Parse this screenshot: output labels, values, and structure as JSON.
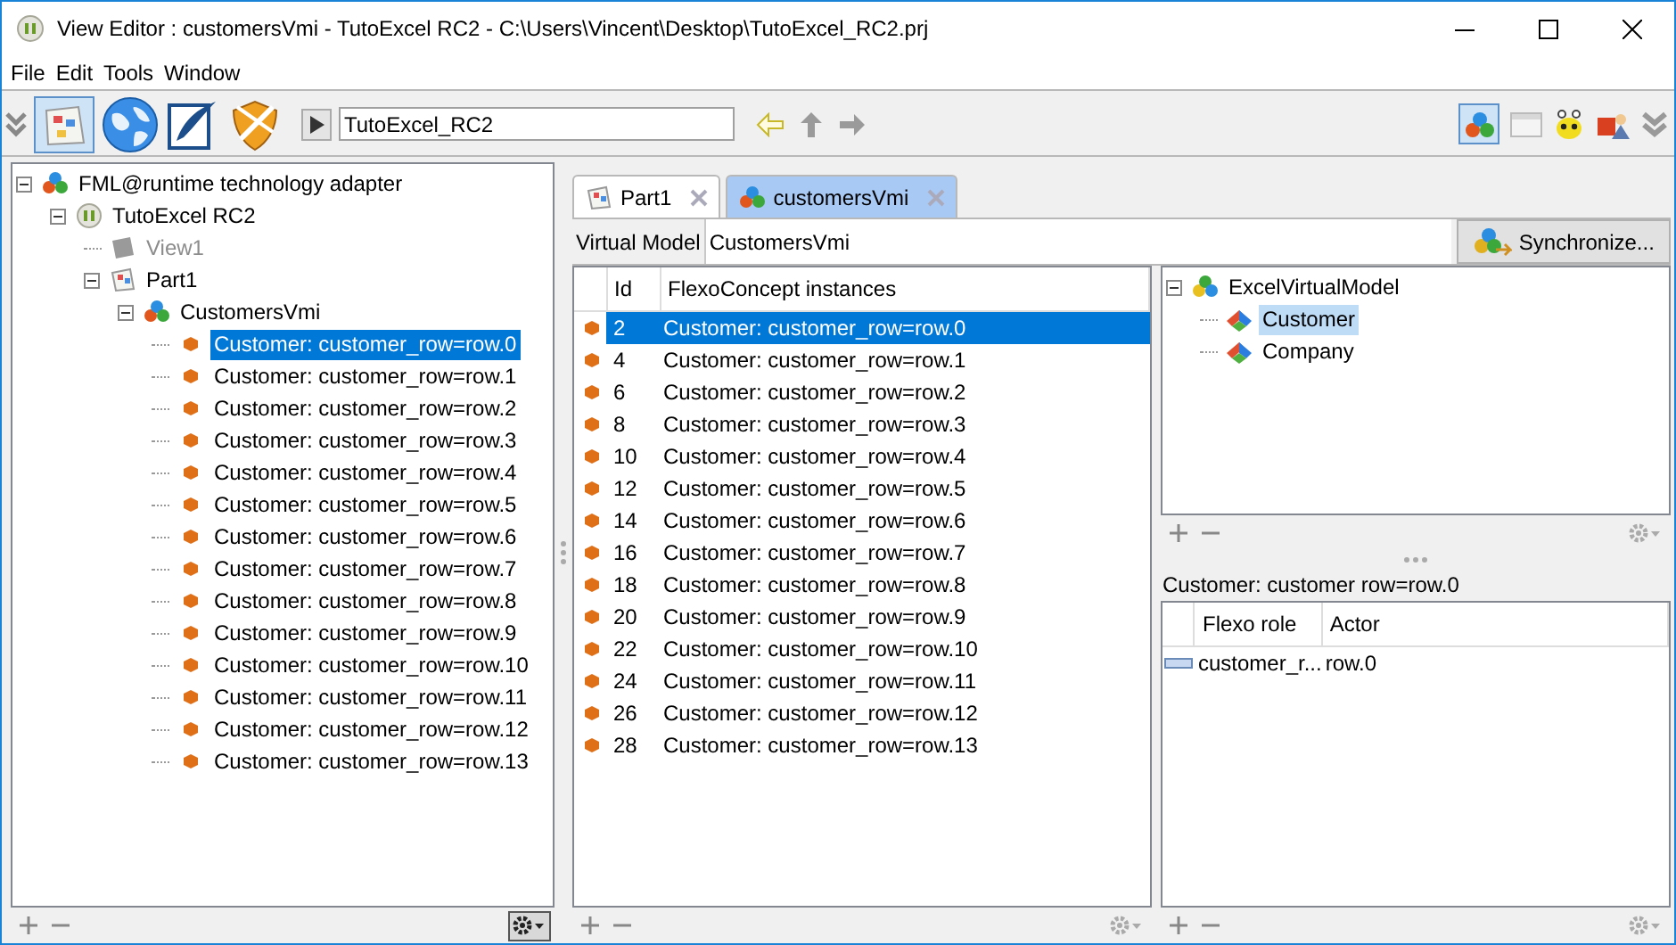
{
  "window": {
    "title": "View Editor : customersVmi - TutoExcel RC2 - C:\\Users\\Vincent\\Desktop\\TutoExcel_RC2.prj"
  },
  "menu": [
    "File",
    "Edit",
    "Tools",
    "Window"
  ],
  "toolbar": {
    "path_field": "TutoExcel_RC2"
  },
  "project_tree": [
    {
      "label": "FML@runtime technology adapter",
      "kind": "adapter",
      "expanded": true,
      "selected": false,
      "disabled": false,
      "children": [
        {
          "label": "TutoExcel RC2",
          "kind": "project",
          "expanded": true,
          "selected": false,
          "disabled": false,
          "children": [
            {
              "label": "View1",
              "kind": "view",
              "selected": false,
              "disabled": true
            },
            {
              "label": "Part1",
              "kind": "part",
              "expanded": true,
              "selected": false,
              "disabled": false,
              "children": [
                {
                  "label": "CustomersVmi",
                  "kind": "vmi",
                  "expanded": true,
                  "selected": false,
                  "disabled": false,
                  "children": [
                    {
                      "label": "Customer: customer_row=row.0",
                      "kind": "instance",
                      "selected": true,
                      "disabled": false
                    },
                    {
                      "label": "Customer: customer_row=row.1",
                      "kind": "instance",
                      "selected": false,
                      "disabled": false
                    },
                    {
                      "label": "Customer: customer_row=row.2",
                      "kind": "instance",
                      "selected": false,
                      "disabled": false
                    },
                    {
                      "label": "Customer: customer_row=row.3",
                      "kind": "instance",
                      "selected": false,
                      "disabled": false
                    },
                    {
                      "label": "Customer: customer_row=row.4",
                      "kind": "instance",
                      "selected": false,
                      "disabled": false
                    },
                    {
                      "label": "Customer: customer_row=row.5",
                      "kind": "instance",
                      "selected": false,
                      "disabled": false
                    },
                    {
                      "label": "Customer: customer_row=row.6",
                      "kind": "instance",
                      "selected": false,
                      "disabled": false
                    },
                    {
                      "label": "Customer: customer_row=row.7",
                      "kind": "instance",
                      "selected": false,
                      "disabled": false
                    },
                    {
                      "label": "Customer: customer_row=row.8",
                      "kind": "instance",
                      "selected": false,
                      "disabled": false
                    },
                    {
                      "label": "Customer: customer_row=row.9",
                      "kind": "instance",
                      "selected": false,
                      "disabled": false
                    },
                    {
                      "label": "Customer: customer_row=row.10",
                      "kind": "instance",
                      "selected": false,
                      "disabled": false
                    },
                    {
                      "label": "Customer: customer_row=row.11",
                      "kind": "instance",
                      "selected": false,
                      "disabled": false
                    },
                    {
                      "label": "Customer: customer_row=row.12",
                      "kind": "instance",
                      "selected": false,
                      "disabled": false
                    },
                    {
                      "label": "Customer: customer_row=row.13",
                      "kind": "instance",
                      "selected": false,
                      "disabled": false
                    }
                  ]
                }
              ]
            }
          ]
        }
      ]
    }
  ],
  "tabs": [
    {
      "label": "Part1",
      "kind": "part",
      "selected": false
    },
    {
      "label": "customersVmi",
      "kind": "vmi",
      "selected": true
    }
  ],
  "virtual_model": {
    "label": "Virtual Model",
    "value": "CustomersVmi",
    "button": "Synchronize..."
  },
  "instances_table": {
    "columns": [
      "Id",
      "FlexoConcept instances"
    ],
    "rows": [
      {
        "id": "2",
        "label": "Customer: customer_row=row.0",
        "selected": true
      },
      {
        "id": "4",
        "label": "Customer: customer_row=row.1",
        "selected": false
      },
      {
        "id": "6",
        "label": "Customer: customer_row=row.2",
        "selected": false
      },
      {
        "id": "8",
        "label": "Customer: customer_row=row.3",
        "selected": false
      },
      {
        "id": "10",
        "label": "Customer: customer_row=row.4",
        "selected": false
      },
      {
        "id": "12",
        "label": "Customer: customer_row=row.5",
        "selected": false
      },
      {
        "id": "14",
        "label": "Customer: customer_row=row.6",
        "selected": false
      },
      {
        "id": "16",
        "label": "Customer: customer_row=row.7",
        "selected": false
      },
      {
        "id": "18",
        "label": "Customer: customer_row=row.8",
        "selected": false
      },
      {
        "id": "20",
        "label": "Customer: customer_row=row.9",
        "selected": false
      },
      {
        "id": "22",
        "label": "Customer: customer_row=row.10",
        "selected": false
      },
      {
        "id": "24",
        "label": "Customer: customer_row=row.11",
        "selected": false
      },
      {
        "id": "26",
        "label": "Customer: customer_row=row.12",
        "selected": false
      },
      {
        "id": "28",
        "label": "Customer: customer_row=row.13",
        "selected": false
      }
    ]
  },
  "concept_tree": [
    {
      "label": "ExcelVirtualModel",
      "kind": "model",
      "expanded": true,
      "selected": false,
      "disabled": false,
      "children": [
        {
          "label": "Customer",
          "kind": "concept",
          "selected": true,
          "disabled": false
        },
        {
          "label": "Company",
          "kind": "concept",
          "selected": false,
          "disabled": false
        }
      ]
    }
  ],
  "detail": {
    "title": "Customer: customer row=row.0",
    "columns": [
      "Flexo role",
      "Actor"
    ],
    "rows": [
      {
        "role": "customer_r...",
        "actor": "row.0"
      }
    ]
  }
}
